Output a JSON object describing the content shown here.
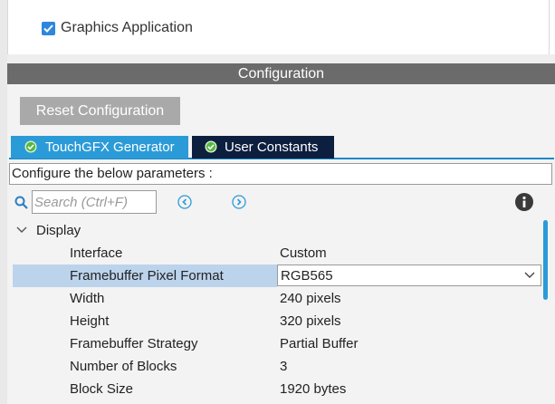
{
  "app": {
    "checkbox_label": "Graphics Application",
    "checked": true
  },
  "config": {
    "header": "Configuration",
    "reset_label": "Reset Configuration",
    "tabs": [
      {
        "label": "TouchGFX Generator",
        "active": true
      },
      {
        "label": "User Constants",
        "active": false
      }
    ],
    "instruction": "Configure the below parameters :",
    "search_placeholder": "Search (Ctrl+F)",
    "group": {
      "label": "Display",
      "expanded": true,
      "params": [
        {
          "name": "Interface",
          "value": "Custom"
        },
        {
          "name": "Framebuffer Pixel Format",
          "value": "RGB565",
          "selected": true
        },
        {
          "name": "Width",
          "value": "240 pixels"
        },
        {
          "name": "Height",
          "value": "320 pixels"
        },
        {
          "name": "Framebuffer Strategy",
          "value": "Partial Buffer"
        },
        {
          "name": "Number of Blocks",
          "value": "3"
        },
        {
          "name": "Block Size",
          "value": "1920 bytes"
        }
      ]
    }
  },
  "colors": {
    "accent": "#2b9bd8",
    "header_bg": "#6b6b6b",
    "selected_row": "#bcd3ec",
    "inactive_tab": "#0d1f3f"
  },
  "icons": {
    "checkbox": "check-icon",
    "tab": "check-circle-icon",
    "search": "search-icon",
    "prev": "arrow-left-circle-icon",
    "next": "arrow-right-circle-icon",
    "info": "info-icon",
    "group": "chevron-down-icon",
    "select": "chevron-down-icon"
  }
}
